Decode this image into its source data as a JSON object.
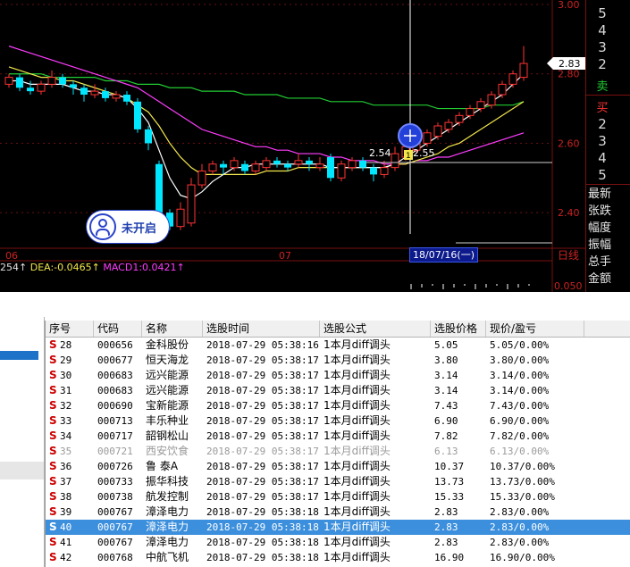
{
  "price_axis": {
    "ticks": [
      "3.00",
      "2.80",
      "2.60",
      "2.40"
    ],
    "current_price_tag": "2.83"
  },
  "bottom_axis": {
    "month_labels": [
      "06",
      "07"
    ],
    "right_label": "日线",
    "macd_tick": "0.050"
  },
  "crosshair": {
    "date_label": "18/07/16(一)",
    "price_labels": [
      "2.54",
      "1",
      "2.55"
    ]
  },
  "indicator_line": {
    "prefix": "254↑",
    "dea": "DEA:-0.0465↑",
    "macd": "MACD1:0.0421↑"
  },
  "badge": {
    "label": "未开启"
  },
  "order_book": {
    "sell_levels": [
      "5",
      "4",
      "3",
      "2"
    ],
    "sell_label": "卖",
    "buy_label": "买",
    "buy_levels": [
      "2",
      "3",
      "4",
      "5"
    ],
    "menu": [
      "最新",
      "张跌",
      "幅度",
      "振幅",
      "总手",
      "金额"
    ]
  },
  "table": {
    "columns": [
      "序号",
      "代码",
      "名称",
      "选股时间",
      "选股公式",
      "选股价格",
      "现价/盈亏"
    ],
    "rows": [
      {
        "flag": "S",
        "no": "28",
        "code": "000656",
        "name": "金科股份",
        "time": "2018-07-29 05:38:16",
        "formula": "1本月diff调头",
        "price": "5.05",
        "now": "5.05/0.00%"
      },
      {
        "flag": "S",
        "no": "29",
        "code": "000677",
        "name": "恒天海龙",
        "time": "2018-07-29 05:38:17",
        "formula": "1本月diff调头",
        "price": "3.80",
        "now": "3.80/0.00%"
      },
      {
        "flag": "S",
        "no": "30",
        "code": "000683",
        "name": "远兴能源",
        "time": "2018-07-29 05:38:17",
        "formula": "1本月diff调头",
        "price": "3.14",
        "now": "3.14/0.00%"
      },
      {
        "flag": "S",
        "no": "31",
        "code": "000683",
        "name": "远兴能源",
        "time": "2018-07-29 05:38:17",
        "formula": "1本月diff调头",
        "price": "3.14",
        "now": "3.14/0.00%"
      },
      {
        "flag": "S",
        "no": "32",
        "code": "000690",
        "name": "宝新能源",
        "time": "2018-07-29 05:38:17",
        "formula": "1本月diff调头",
        "price": "7.43",
        "now": "7.43/0.00%"
      },
      {
        "flag": "S",
        "no": "33",
        "code": "000713",
        "name": "丰乐种业",
        "time": "2018-07-29 05:38:17",
        "formula": "1本月diff调头",
        "price": "6.90",
        "now": "6.90/0.00%"
      },
      {
        "flag": "S",
        "no": "34",
        "code": "000717",
        "name": "韶钢松山",
        "time": "2018-07-29 05:38:17",
        "formula": "1本月diff调头",
        "price": "7.82",
        "now": "7.82/0.00%"
      },
      {
        "flag": "S",
        "no": "35",
        "code": "000721",
        "name": "西安饮食",
        "time": "2018-07-29 05:38:17",
        "formula": "1本月diff调头",
        "price": "6.13",
        "now": "6.13/0.00%"
      },
      {
        "flag": "S",
        "no": "36",
        "code": "000726",
        "name": "鲁  泰A",
        "time": "2018-07-29 05:38:17",
        "formula": "1本月diff调头",
        "price": "10.37",
        "now": "10.37/0.00%"
      },
      {
        "flag": "S",
        "no": "37",
        "code": "000733",
        "name": "振华科技",
        "time": "2018-07-29 05:38:17",
        "formula": "1本月diff调头",
        "price": "13.73",
        "now": "13.73/0.00%"
      },
      {
        "flag": "S",
        "no": "38",
        "code": "000738",
        "name": "航发控制",
        "time": "2018-07-29 05:38:17",
        "formula": "1本月diff调头",
        "price": "15.33",
        "now": "15.33/0.00%"
      },
      {
        "flag": "S",
        "no": "39",
        "code": "000767",
        "name": "漳泽电力",
        "time": "2018-07-29 05:38:18",
        "formula": "1本月diff调头",
        "price": "2.83",
        "now": "2.83/0.00%"
      },
      {
        "flag": "S",
        "no": "40",
        "code": "000767",
        "name": "漳泽电力",
        "time": "2018-07-29 05:38:18",
        "formula": "1本月diff调头",
        "price": "2.83",
        "now": "2.83/0.00%"
      },
      {
        "flag": "S",
        "no": "41",
        "code": "000767",
        "name": "漳泽电力",
        "time": "2018-07-29 05:38:18",
        "formula": "1本月diff调头",
        "price": "2.83",
        "now": "2.83/0.00%"
      },
      {
        "flag": "S",
        "no": "42",
        "code": "000768",
        "name": "中航飞机",
        "time": "2018-07-29 05:38:18",
        "formula": "1本月diff调头",
        "price": "16.90",
        "now": "16.90/0.00%"
      }
    ]
  },
  "colors": {
    "up": "#ff3333",
    "down": "#00e6ff",
    "ma_fast": "#ffffff",
    "ma_mid": "#f2e64a",
    "ma_slow": "#ff3cff",
    "ma_long": "#22cc33",
    "selected_row": "#3c8fdc"
  },
  "chart_data": {
    "type": "candlestick",
    "ylim": [
      2.3,
      3.0
    ],
    "candles": [
      {
        "o": 2.77,
        "c": 2.79,
        "h": 2.8,
        "l": 2.76
      },
      {
        "o": 2.79,
        "c": 2.76,
        "h": 2.8,
        "l": 2.75
      },
      {
        "o": 2.76,
        "c": 2.75,
        "h": 2.78,
        "l": 2.74
      },
      {
        "o": 2.75,
        "c": 2.77,
        "h": 2.78,
        "l": 2.74
      },
      {
        "o": 2.77,
        "c": 2.79,
        "h": 2.81,
        "l": 2.76
      },
      {
        "o": 2.79,
        "c": 2.77,
        "h": 2.8,
        "l": 2.76
      },
      {
        "o": 2.77,
        "c": 2.76,
        "h": 2.78,
        "l": 2.74
      },
      {
        "o": 2.76,
        "c": 2.74,
        "h": 2.77,
        "l": 2.72
      },
      {
        "o": 2.74,
        "c": 2.75,
        "h": 2.77,
        "l": 2.73
      },
      {
        "o": 2.75,
        "c": 2.73,
        "h": 2.76,
        "l": 2.72
      },
      {
        "o": 2.73,
        "c": 2.74,
        "h": 2.75,
        "l": 2.72
      },
      {
        "o": 2.74,
        "c": 2.72,
        "h": 2.75,
        "l": 2.71
      },
      {
        "o": 2.72,
        "c": 2.64,
        "h": 2.73,
        "l": 2.63
      },
      {
        "o": 2.64,
        "c": 2.6,
        "h": 2.65,
        "l": 2.58
      },
      {
        "o": 2.54,
        "c": 2.4,
        "h": 2.55,
        "l": 2.37
      },
      {
        "o": 2.4,
        "c": 2.36,
        "h": 2.41,
        "l": 2.35
      },
      {
        "o": 2.36,
        "c": 2.41,
        "h": 2.43,
        "l": 2.35
      },
      {
        "o": 2.37,
        "c": 2.48,
        "h": 2.5,
        "l": 2.36
      },
      {
        "o": 2.48,
        "c": 2.52,
        "h": 2.54,
        "l": 2.47
      },
      {
        "o": 2.52,
        "c": 2.54,
        "h": 2.55,
        "l": 2.51
      },
      {
        "o": 2.54,
        "c": 2.53,
        "h": 2.55,
        "l": 2.51
      },
      {
        "o": 2.53,
        "c": 2.55,
        "h": 2.56,
        "l": 2.52
      },
      {
        "o": 2.54,
        "c": 2.52,
        "h": 2.55,
        "l": 2.51
      },
      {
        "o": 2.52,
        "c": 2.54,
        "h": 2.55,
        "l": 2.51
      },
      {
        "o": 2.53,
        "c": 2.55,
        "h": 2.56,
        "l": 2.52
      },
      {
        "o": 2.55,
        "c": 2.54,
        "h": 2.56,
        "l": 2.53
      },
      {
        "o": 2.54,
        "c": 2.53,
        "h": 2.55,
        "l": 2.52
      },
      {
        "o": 2.54,
        "c": 2.55,
        "h": 2.57,
        "l": 2.53
      },
      {
        "o": 2.55,
        "c": 2.54,
        "h": 2.56,
        "l": 2.52
      },
      {
        "o": 2.53,
        "c": 2.54,
        "h": 2.56,
        "l": 2.52
      },
      {
        "o": 2.56,
        "c": 2.5,
        "h": 2.57,
        "l": 2.49
      },
      {
        "o": 2.5,
        "c": 2.54,
        "h": 2.55,
        "l": 2.49
      },
      {
        "o": 2.53,
        "c": 2.55,
        "h": 2.56,
        "l": 2.52
      },
      {
        "o": 2.55,
        "c": 2.53,
        "h": 2.56,
        "l": 2.52
      },
      {
        "o": 2.53,
        "c": 2.51,
        "h": 2.54,
        "l": 2.49
      },
      {
        "o": 2.51,
        "c": 2.53,
        "h": 2.55,
        "l": 2.5
      },
      {
        "o": 2.53,
        "c": 2.57,
        "h": 2.59,
        "l": 2.52
      },
      {
        "o": 2.56,
        "c": 2.59,
        "h": 2.61,
        "l": 2.55
      },
      {
        "o": 2.58,
        "c": 2.61,
        "h": 2.62,
        "l": 2.57
      },
      {
        "o": 2.6,
        "c": 2.63,
        "h": 2.64,
        "l": 2.59
      },
      {
        "o": 2.62,
        "c": 2.65,
        "h": 2.66,
        "l": 2.61
      },
      {
        "o": 2.64,
        "c": 2.66,
        "h": 2.67,
        "l": 2.63
      },
      {
        "o": 2.66,
        "c": 2.68,
        "h": 2.69,
        "l": 2.65
      },
      {
        "o": 2.68,
        "c": 2.7,
        "h": 2.71,
        "l": 2.67
      },
      {
        "o": 2.7,
        "c": 2.72,
        "h": 2.73,
        "l": 2.69
      },
      {
        "o": 2.71,
        "c": 2.74,
        "h": 2.75,
        "l": 2.7
      },
      {
        "o": 2.74,
        "c": 2.77,
        "h": 2.78,
        "l": 2.73
      },
      {
        "o": 2.77,
        "c": 2.8,
        "h": 2.81,
        "l": 2.76
      },
      {
        "o": 2.79,
        "c": 2.83,
        "h": 2.88,
        "l": 2.78
      }
    ],
    "ma_fast": [
      2.78,
      2.78,
      2.77,
      2.77,
      2.77,
      2.77,
      2.76,
      2.75,
      2.75,
      2.74,
      2.74,
      2.73,
      2.7,
      2.66,
      2.58,
      2.5,
      2.45,
      2.44,
      2.46,
      2.49,
      2.51,
      2.53,
      2.53,
      2.54,
      2.54,
      2.54,
      2.54,
      2.54,
      2.54,
      2.54,
      2.53,
      2.53,
      2.53,
      2.53,
      2.53,
      2.53,
      2.54,
      2.56,
      2.58,
      2.6,
      2.62,
      2.64,
      2.66,
      2.68,
      2.7,
      2.72,
      2.74,
      2.77,
      2.8
    ],
    "ma_mid": [
      2.82,
      2.81,
      2.8,
      2.79,
      2.79,
      2.78,
      2.78,
      2.77,
      2.76,
      2.75,
      2.74,
      2.73,
      2.71,
      2.69,
      2.65,
      2.6,
      2.56,
      2.53,
      2.51,
      2.51,
      2.51,
      2.51,
      2.51,
      2.51,
      2.52,
      2.52,
      2.52,
      2.53,
      2.53,
      2.53,
      2.53,
      2.53,
      2.53,
      2.53,
      2.53,
      2.53,
      2.54,
      2.54,
      2.55,
      2.56,
      2.57,
      2.59,
      2.6,
      2.62,
      2.64,
      2.66,
      2.68,
      2.7,
      2.72
    ],
    "ma_slow": [
      2.88,
      2.87,
      2.86,
      2.85,
      2.84,
      2.83,
      2.82,
      2.81,
      2.8,
      2.79,
      2.78,
      2.77,
      2.76,
      2.74,
      2.72,
      2.7,
      2.68,
      2.66,
      2.64,
      2.63,
      2.62,
      2.61,
      2.6,
      2.59,
      2.59,
      2.58,
      2.58,
      2.57,
      2.57,
      2.57,
      2.56,
      2.56,
      2.55,
      2.55,
      2.55,
      2.54,
      2.54,
      2.54,
      2.55,
      2.55,
      2.56,
      2.56,
      2.57,
      2.58,
      2.59,
      2.6,
      2.61,
      2.62,
      2.63
    ],
    "ma_long": [
      2.8,
      2.8,
      2.8,
      2.8,
      2.79,
      2.79,
      2.79,
      2.79,
      2.79,
      2.78,
      2.78,
      2.78,
      2.77,
      2.77,
      2.77,
      2.76,
      2.76,
      2.76,
      2.75,
      2.75,
      2.75,
      2.75,
      2.74,
      2.74,
      2.74,
      2.74,
      2.73,
      2.73,
      2.73,
      2.73,
      2.72,
      2.72,
      2.72,
      2.72,
      2.71,
      2.71,
      2.71,
      2.71,
      2.71,
      2.71,
      2.7,
      2.7,
      2.7,
      2.7,
      2.7,
      2.71,
      2.71,
      2.71,
      2.72
    ]
  }
}
